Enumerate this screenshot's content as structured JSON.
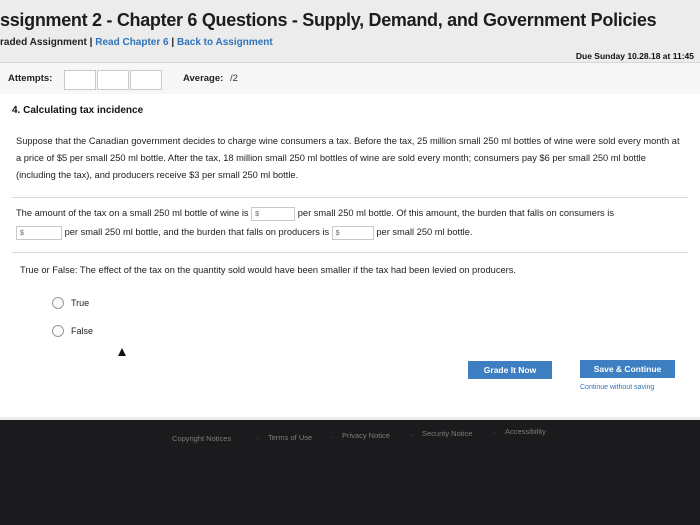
{
  "header": {
    "title": "ssignment 2 - Chapter 6 Questions - Supply, Demand, and Government Policies",
    "graded_label": "raded Assignment",
    "read_chapter_link": "Read Chapter 6",
    "back_link": "Back to Assignment",
    "separator": "|",
    "due": "Due Sunday 10.28.18 at 11:45"
  },
  "attempts": {
    "label": "Attempts:",
    "average_label": "Average:",
    "average_value": "/2"
  },
  "question": {
    "heading": "4. Calculating tax incidence",
    "paragraph": "Suppose that the Canadian government decides to charge wine consumers a tax. Before the tax, 25 million small 250 ml bottles of wine were sold every month at a price of $5 per small 250 ml bottle. After the tax, 18 million small 250 ml bottles of wine are sold every month; consumers pay $6 per small 250 ml bottle (including the tax), and producers receive $3 per small 250 ml bottle.",
    "fill": {
      "part1": "The amount of the tax on a small 250 ml bottle of wine is",
      "part2": "per small 250 ml bottle. Of this amount, the burden that falls on consumers is",
      "part3": "per small 250 ml bottle, and the burden that falls on producers is",
      "part4": "per small 250 ml bottle.",
      "currency": "$"
    },
    "tf_question": "True or False: The effect of the tax on the quantity sold would have been smaller if the tax had been levied on producers.",
    "options": [
      "True",
      "False"
    ]
  },
  "actions": {
    "grade": "Grade It Now",
    "save": "Save & Continue",
    "continue_link": "Continue without saving"
  },
  "footer": {
    "links": [
      "Copyright Notices",
      "Terms of Use",
      "Privacy Notice",
      "Security Notice",
      "Accessibility"
    ],
    "dot": "·"
  }
}
